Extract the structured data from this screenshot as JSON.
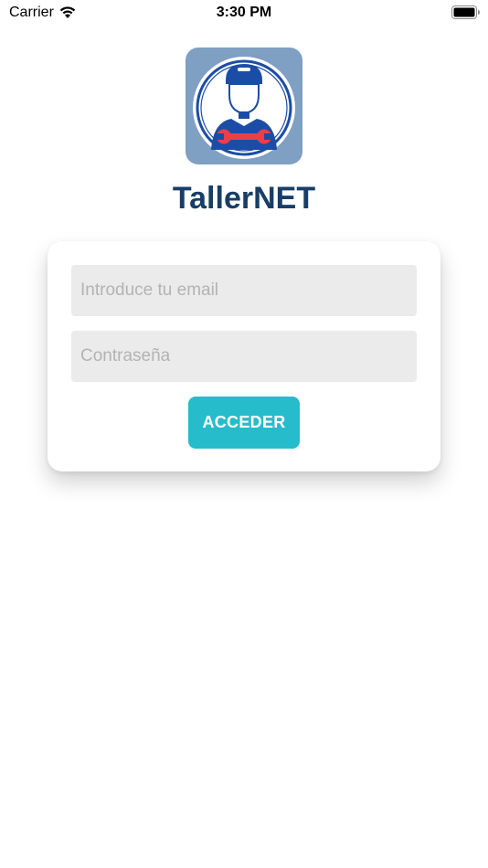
{
  "status_bar": {
    "carrier": "Carrier",
    "time": "3:30 PM",
    "icons": [
      "wifi-icon",
      "battery-icon"
    ]
  },
  "app": {
    "title": "TallerNET",
    "logo_icon": "mechanic-logo-icon",
    "colors": {
      "title": "#183e66",
      "logo_background": "#7f9fc3",
      "logo_figure": "#1c4da6",
      "wrench": "#e8404a",
      "button": "#26bccb"
    }
  },
  "login": {
    "email_placeholder": "Introduce tu email",
    "email_value": "",
    "password_placeholder": "Contraseña",
    "password_value": "",
    "submit_label": "ACCEDER"
  }
}
